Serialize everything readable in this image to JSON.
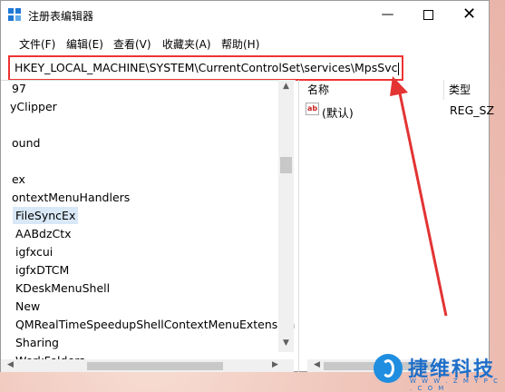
{
  "window": {
    "title": "注册表编辑器"
  },
  "menu": [
    "文件(F)",
    "编辑(E)",
    "查看(V)",
    "收藏夹(A)",
    "帮助(H)"
  ],
  "address": "HKEY_LOCAL_MACHINE\\SYSTEM\\CurrentControlSet\\services\\MpsSvc",
  "tree": [
    "97",
    "yClipper",
    "",
    "ound",
    "",
    "ex",
    "ontextMenuHandlers",
    "FileSyncEx",
    "AABdzCtx",
    "igfxcui",
    "igfxDTCM",
    "KDeskMenuShell",
    "New",
    "QMRealTimeSpeedupShellContextMenuExtension",
    "Sharing",
    "WorkFolders"
  ],
  "selected_index": 7,
  "values_pane": {
    "col_name": "名称",
    "col_type": "类型",
    "rows": [
      {
        "icon": "ab",
        "name": "(默认)",
        "type": "REG_SZ"
      }
    ]
  },
  "watermark": {
    "brand": "捷维科技",
    "url": "W W W . Z M Y P C . C O M"
  },
  "colors": {
    "highlight_border": "#e33333",
    "arrow": "#e33333",
    "selection": "#d9e8f7",
    "brand": "#1f6fc9"
  }
}
